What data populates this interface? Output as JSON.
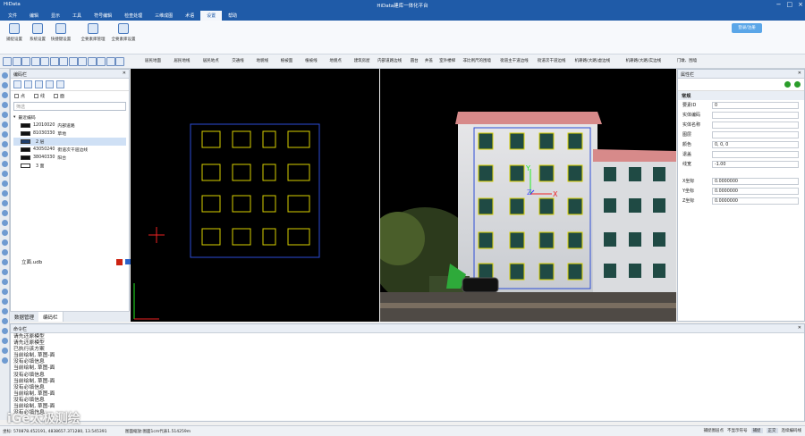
{
  "title": {
    "app": "HiData",
    "center": "HiData建库一体化平台",
    "min": "−",
    "max": "□",
    "close": "×"
  },
  "menu": [
    "文件",
    "编辑",
    "显示",
    "工具",
    "符号编辑",
    "检查处理",
    "三维成图",
    "术语",
    "设置",
    "帮助"
  ],
  "menu_active": 8,
  "ribbon": {
    "buttons": [
      "捕捉设置",
      "系统设置",
      "快捷键设置",
      "全要素库管理",
      "全要素库设置"
    ],
    "login": "登录/注册"
  },
  "toolbar_items": [
    "居民地面",
    "居民地线",
    "居民地点",
    "交通线",
    "地貌线",
    "植被面",
    "植被线",
    "地貌点",
    "建筑房屋",
    "内部道路边线",
    "圆台",
    "井盖",
    "室外楼梯",
    "非比例尺的围墙",
    "街道主干道边线",
    "街道次干道边线",
    "机耕路(大路)虚边线",
    "机耕路(大路)实边线",
    "门墩、围墙"
  ],
  "code_panel": {
    "title": "编码栏",
    "check_point": "点",
    "check_line": "线",
    "check_face": "面",
    "filter_placeholder": "筛选",
    "root": "最近编码",
    "items": [
      {
        "code": "12010020",
        "name": "内部道路"
      },
      {
        "code": "81030330",
        "name": "草地"
      },
      {
        "code": "",
        "name": "2 层"
      },
      {
        "code": "43050240",
        "name": "街道次干道边线"
      },
      {
        "code": "38040330",
        "name": "阳台"
      },
      {
        "code": "",
        "name": "3 面"
      }
    ],
    "file": "立面.udb"
  },
  "left_tabs": [
    "数据管理",
    "编码栏"
  ],
  "props_panel": {
    "title": "属性栏",
    "section": "常规",
    "rows": [
      {
        "k": "要素ID",
        "v": "0"
      },
      {
        "k": "实体编码",
        "v": ""
      },
      {
        "k": "实体名称",
        "v": ""
      },
      {
        "k": "图层",
        "v": ""
      },
      {
        "k": "颜色",
        "v": "0, 0, 0"
      },
      {
        "k": "退盖",
        "v": ""
      },
      {
        "k": "线宽",
        "v": "-1.00"
      },
      {
        "k": "X坐标",
        "v": "0.0000000"
      },
      {
        "k": "Y坐标",
        "v": "0.0000000"
      },
      {
        "k": "Z坐标",
        "v": "0.0000000"
      }
    ]
  },
  "cmd_panel": {
    "title": "命令栏",
    "lines": [
      "请先还原模型",
      "请先还原模型",
      "已执行该方案",
      "当前绘制, 草图-面",
      "没有必填信息",
      "当前绘制, 草图-面",
      "没有必填信息",
      "当前绘制, 草图-面",
      "没有必填信息",
      "当前绘制, 草图-面",
      "没有必填信息",
      "当前绘制, 草图-面",
      "没有必填信息"
    ]
  },
  "status": {
    "coords": "坐标: 570878.452191, 4838657.371280, 13.545391",
    "scale": "图面缩放:图面1cm代表1.514259m",
    "right": [
      "捕捉图层点",
      "不显示符号",
      "捕捉",
      "正交",
      "连续编码线"
    ]
  },
  "watermark": "iGe太极测绘",
  "axis": {
    "x": "X",
    "y": "Y",
    "z": "Z"
  },
  "colors": {
    "title_bar": "#1f5ba8",
    "menu_active": "#f3f6fb",
    "window_yellow": "#d8d000",
    "frame_blue": "#2d4dd6",
    "axis_x": "#e22",
    "axis_y": "#2e2",
    "axis_z": "#33f",
    "selection_red": "#c21"
  }
}
